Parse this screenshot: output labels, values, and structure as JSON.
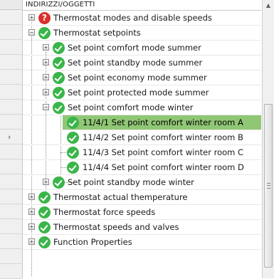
{
  "header": {
    "title": "INDIRIZZI/OGGETTI"
  },
  "tree": {
    "items": [
      {
        "label": "Thermostat modes and disable speeds",
        "status": "warning",
        "expander": "+"
      },
      {
        "label": "Thermostat setpoints",
        "status": "ok",
        "expander": "−"
      },
      {
        "label": "Set point comfort mode summer",
        "status": "ok",
        "expander": "+"
      },
      {
        "label": "Set point standby mode summer",
        "status": "ok",
        "expander": "+"
      },
      {
        "label": "Set point economy mode summer",
        "status": "ok",
        "expander": "+"
      },
      {
        "label": "Set point protected mode summer",
        "status": "ok",
        "expander": "+"
      },
      {
        "label": "Set point comfort mode winter",
        "status": "ok",
        "expander": "−"
      },
      {
        "label": "11/4/1 Set point comfort winter room A",
        "status": "ok",
        "selected": true
      },
      {
        "label": "11/4/2 Set point comfort winter room B",
        "status": "ok"
      },
      {
        "label": "11/4/3 Set point comfort winter room C",
        "status": "ok"
      },
      {
        "label": "11/4/4 Set point comfort winter room D",
        "status": "ok"
      },
      {
        "label": "Set point standby mode winter",
        "status": "ok",
        "expander": "+"
      },
      {
        "label": "Thermostat actual themperature",
        "status": "ok",
        "expander": "+"
      },
      {
        "label": "Thermostat force speeds",
        "status": "ok",
        "expander": "+"
      },
      {
        "label": "Thermostat speeds and valves",
        "status": "ok",
        "expander": "+"
      },
      {
        "label": "Function Properties",
        "status": "ok",
        "expander": "+"
      }
    ]
  },
  "icons": {
    "ok": "check-circle-icon",
    "warning": "question-circle-icon",
    "row_pointer": "row-pointer-arrow-icon",
    "ok_color": "#3ab54a",
    "warning_color": "#d9302c",
    "selected_row_color": "#90c775"
  },
  "glyphs": {
    "row_pointer": "›",
    "warning_mark": "?",
    "scroll_up": "▲"
  }
}
